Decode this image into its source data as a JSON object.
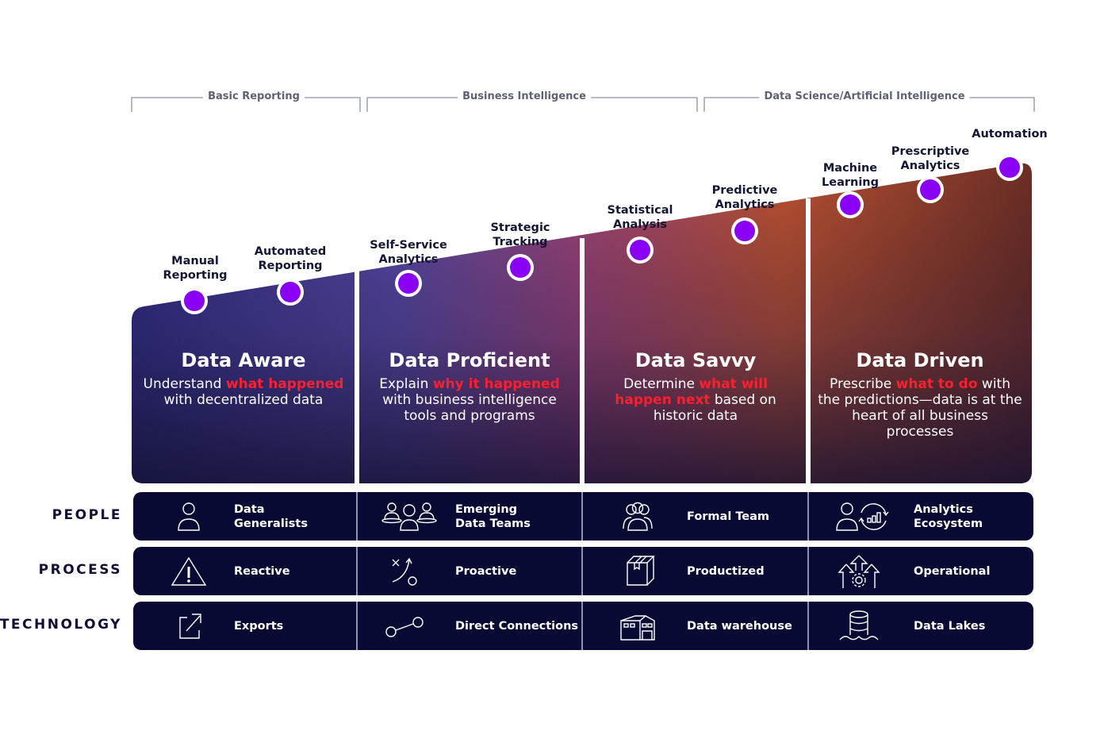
{
  "phases": [
    {
      "label": "Basic Reporting"
    },
    {
      "label": "Business Intelligence"
    },
    {
      "label": "Data Science/Artificial Intelligence"
    }
  ],
  "milestones": [
    {
      "line1": "Manual",
      "line2": "Reporting"
    },
    {
      "line1": "Automated",
      "line2": "Reporting"
    },
    {
      "line1": "Self-Service",
      "line2": "Analytics"
    },
    {
      "line1": "Strategic",
      "line2": "Tracking"
    },
    {
      "line1": "Statistical",
      "line2": "Analysis"
    },
    {
      "line1": "Predictive",
      "line2": "Analytics"
    },
    {
      "line1": "Machine",
      "line2": "Learning"
    },
    {
      "line1": "Prescriptive",
      "line2": "Analytics"
    },
    {
      "line1": "Automation",
      "line2": ""
    }
  ],
  "stages": [
    {
      "title": "Data Aware",
      "pre": "Understand ",
      "highlight": "what happened",
      "post": " with decentralized data"
    },
    {
      "title": "Data Proficient",
      "pre": "Explain ",
      "highlight": "why it happened",
      "post": " with business intelligence tools and programs"
    },
    {
      "title": "Data Savvy",
      "pre": "Determine ",
      "highlight": "what will happen next",
      "post": " based on historic data"
    },
    {
      "title": "Data Driven",
      "pre": "Prescribe ",
      "highlight": "what to do",
      "post": " with the predictions—data is at the heart of all business processes"
    }
  ],
  "rows": [
    {
      "label": "PEOPLE",
      "cells": [
        {
          "icon": "person-icon",
          "text": "Data\nGeneralists"
        },
        {
          "icon": "group-icon",
          "text": "Emerging\nData Teams"
        },
        {
          "icon": "team-icon",
          "text": "Formal Team"
        },
        {
          "icon": "analytics-ecosystem-icon",
          "text": "Analytics\nEcosystem"
        }
      ]
    },
    {
      "label": "PROCESS",
      "cells": [
        {
          "icon": "warning-icon",
          "text": "Reactive"
        },
        {
          "icon": "strategy-play-icon",
          "text": "Proactive"
        },
        {
          "icon": "box-icon",
          "text": "Productized"
        },
        {
          "icon": "gear-arrows-icon",
          "text": "Operational"
        }
      ]
    },
    {
      "label": "TECHNOLOGY",
      "cells": [
        {
          "icon": "export-icon",
          "text": "Exports"
        },
        {
          "icon": "connection-icon",
          "text": "Direct Connections"
        },
        {
          "icon": "warehouse-icon",
          "text": "Data warehouse"
        },
        {
          "icon": "database-lake-icon",
          "text": "Data Lakes"
        }
      ]
    }
  ],
  "colors": {
    "milestone_dot": "#8a00f5",
    "highlight": "#ff1f2d",
    "row_bg": "#090a33",
    "label_text": "#121634",
    "bracket_text": "#5e6075",
    "gradient_blue": "#2c2c86",
    "gradient_purple": "#6a4bb4",
    "gradient_orange": "#c05236",
    "gradient_dark": "#2a0f1c"
  }
}
